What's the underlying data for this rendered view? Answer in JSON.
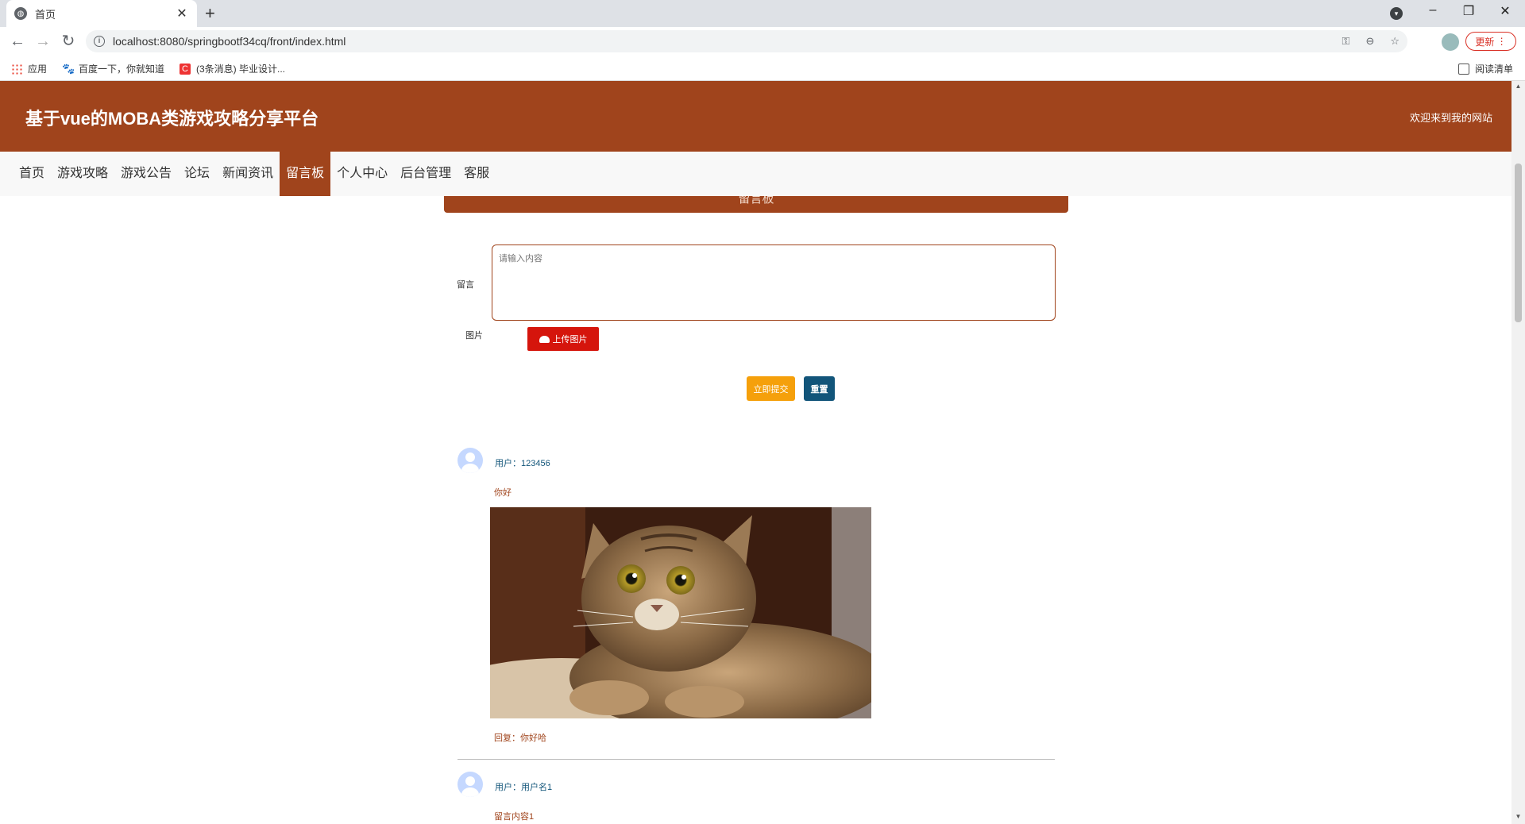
{
  "browser": {
    "tab_title": "首页",
    "url": "localhost:8080/springbootf34cq/front/index.html",
    "update_label": "更新",
    "bookmarks": [
      {
        "label": "应用"
      },
      {
        "label": "百度一下，你就知道"
      },
      {
        "label": "(3条消息) 毕业设计..."
      }
    ],
    "reading_list": "阅读清单"
  },
  "header": {
    "site_title": "基于vue的MOBA类游戏攻略分享平台",
    "welcome": "欢迎来到我的网站"
  },
  "nav": {
    "items": [
      {
        "label": "首页"
      },
      {
        "label": "游戏攻略"
      },
      {
        "label": "游戏公告"
      },
      {
        "label": "论坛"
      },
      {
        "label": "新闻资讯"
      },
      {
        "label": "留言板",
        "active": true
      },
      {
        "label": "个人中心"
      },
      {
        "label": "后台管理"
      },
      {
        "label": "客服"
      }
    ]
  },
  "board": {
    "title": "留言板"
  },
  "form": {
    "message_label": "留言",
    "message_placeholder": "请输入内容",
    "image_label": "图片",
    "upload_label": "上传图片",
    "submit_label": "立即提交",
    "reset_label": "重置"
  },
  "messages": [
    {
      "user": "用户：123456",
      "content": "你好",
      "reply": "回复：你好哈"
    },
    {
      "user": "用户：用户名1",
      "content": "留言内容1"
    }
  ],
  "colors": {
    "brand": "#a0441c",
    "upload": "#d5150c",
    "submit": "#f5a00b",
    "reset": "#12557a"
  }
}
